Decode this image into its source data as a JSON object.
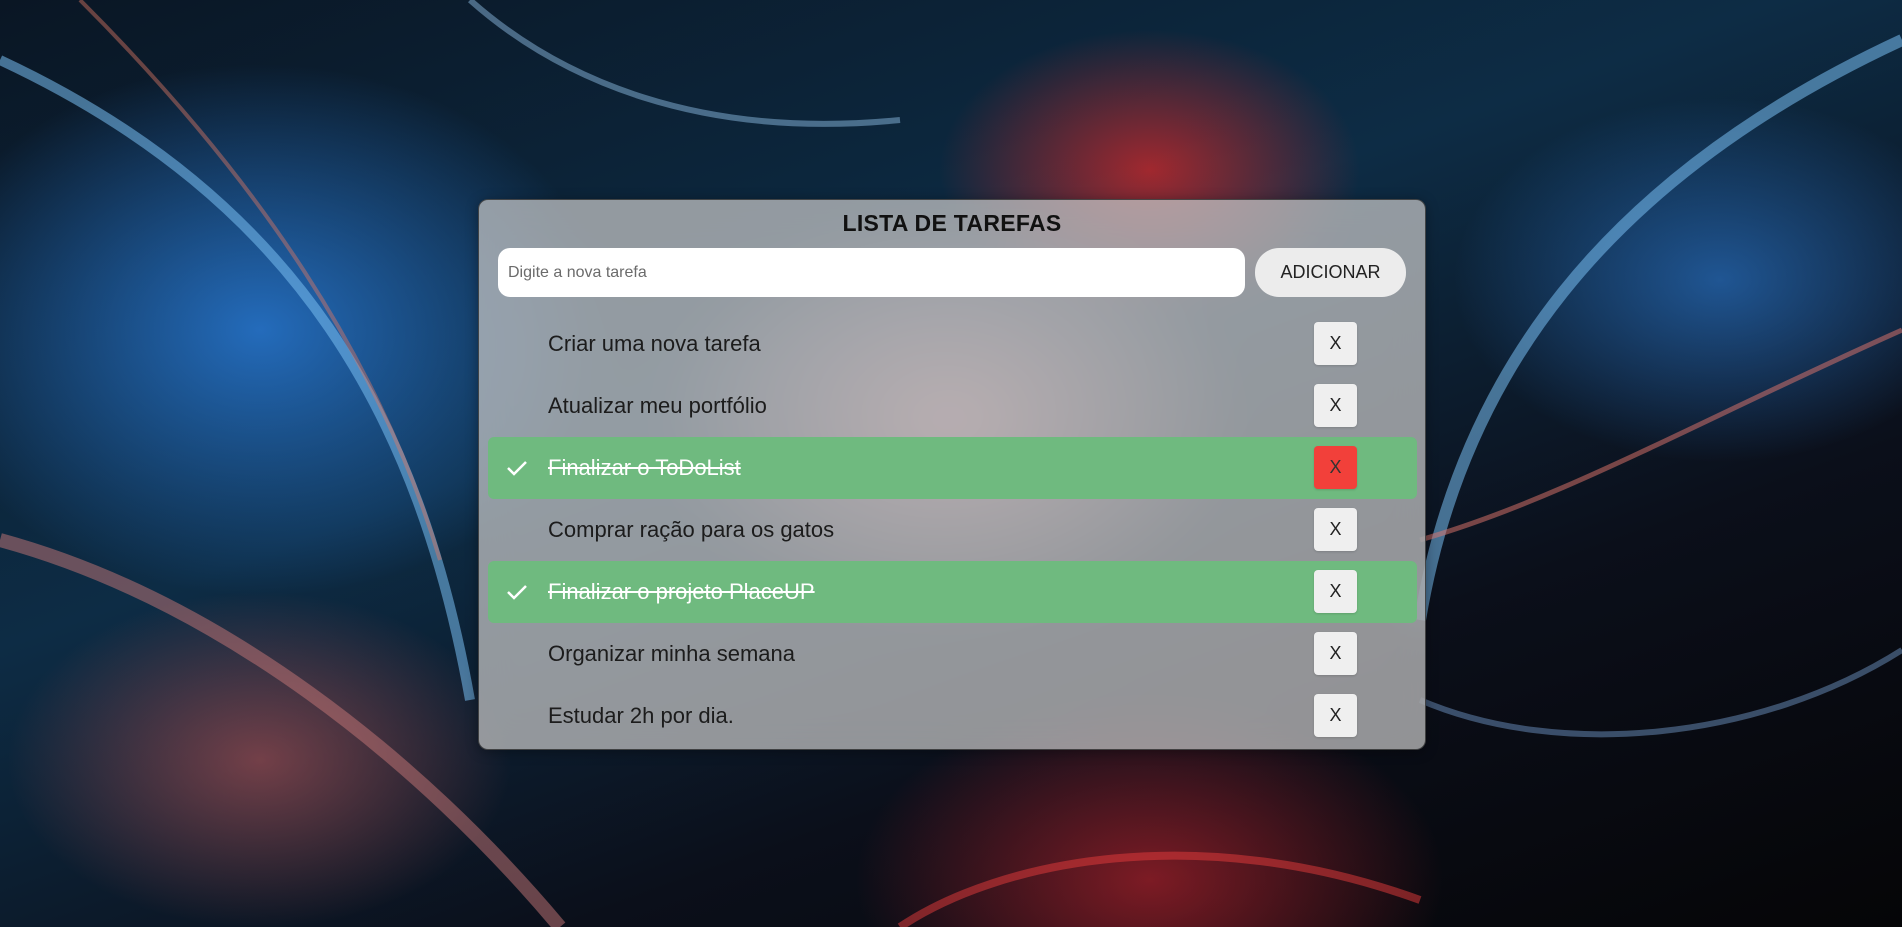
{
  "app": {
    "title": "LISTA DE TAREFAS"
  },
  "input": {
    "placeholder": "Digite a nova tarefa",
    "value": ""
  },
  "add_button": {
    "label": "ADICIONAR"
  },
  "tasks": [
    {
      "text": "Criar uma nova tarefa",
      "done": false,
      "delete_label": "X",
      "delete_hover": false
    },
    {
      "text": "Atualizar meu portfólio",
      "done": false,
      "delete_label": "X",
      "delete_hover": false
    },
    {
      "text": "Finalizar o ToDoList",
      "done": true,
      "delete_label": "X",
      "delete_hover": true
    },
    {
      "text": "Comprar ração para os gatos",
      "done": false,
      "delete_label": "X",
      "delete_hover": false
    },
    {
      "text": "Finalizar o projeto PlaceUP",
      "done": true,
      "delete_label": "X",
      "delete_hover": false
    },
    {
      "text": "Organizar minha semana",
      "done": false,
      "delete_label": "X",
      "delete_hover": false
    },
    {
      "text": "Estudar 2h por dia.",
      "done": false,
      "delete_label": "X",
      "delete_hover": false
    }
  ],
  "icons": {
    "done_marker": "check-icon"
  },
  "colors": {
    "done_row": "#6fba7f",
    "delete_hover": "#f2403a",
    "card": "#c8c8c8"
  }
}
